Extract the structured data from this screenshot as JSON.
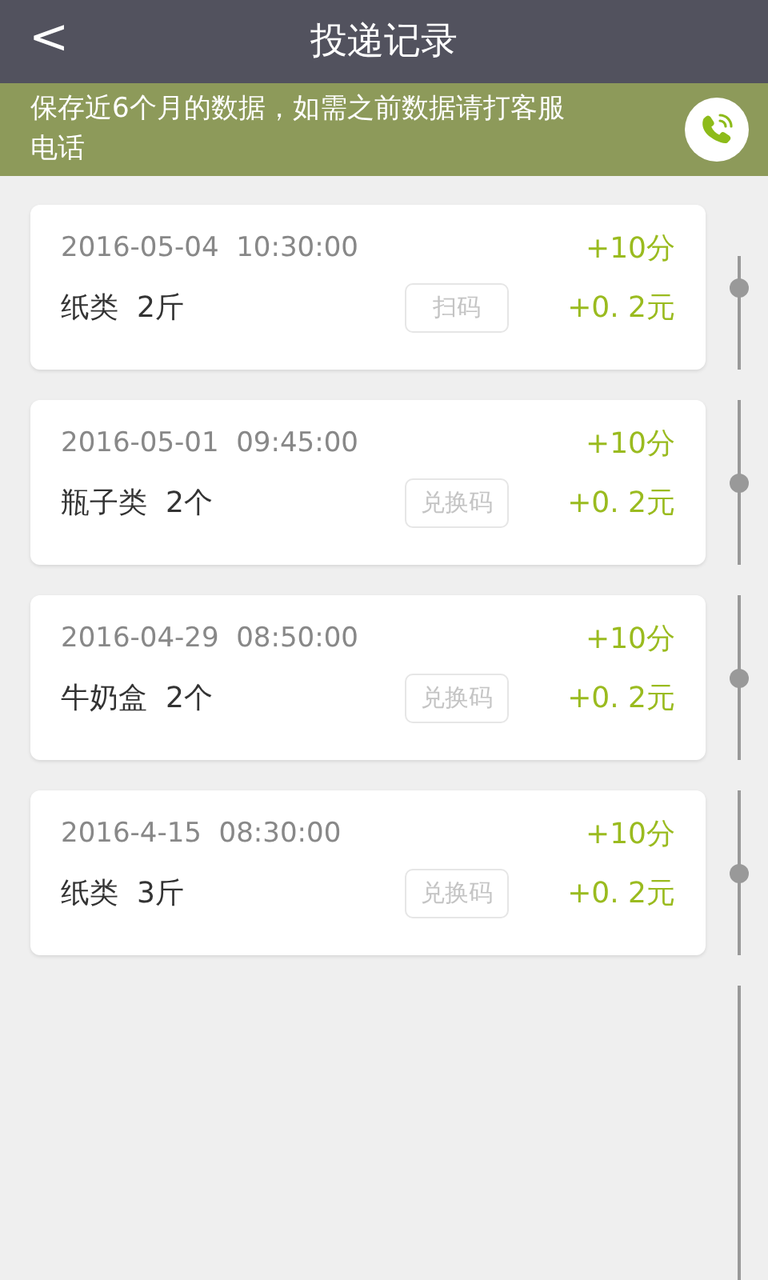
{
  "header": {
    "back": "<",
    "title": "投递记录"
  },
  "notice": {
    "text": "保存近6个月的数据，如需之前数据请打客服电话"
  },
  "records": [
    {
      "datetime": "2016-05-04  10:30:00",
      "points": "+10分",
      "item": "纸类  2斤",
      "code_button": "扫码",
      "money": "+0. 2元"
    },
    {
      "datetime": "2016-05-01  09:45:00",
      "points": "+10分",
      "item": "瓶子类  2个",
      "code_button": "兑换码",
      "money": "+0. 2元"
    },
    {
      "datetime": "2016-04-29  08:50:00",
      "points": "+10分",
      "item": "牛奶盒  2个",
      "code_button": "兑换码",
      "money": "+0. 2元"
    },
    {
      "datetime": "2016-4-15  08:30:00",
      "points": "+10分",
      "item": "纸类  3斤",
      "code_button": "兑换码",
      "money": "+0. 2元"
    }
  ]
}
